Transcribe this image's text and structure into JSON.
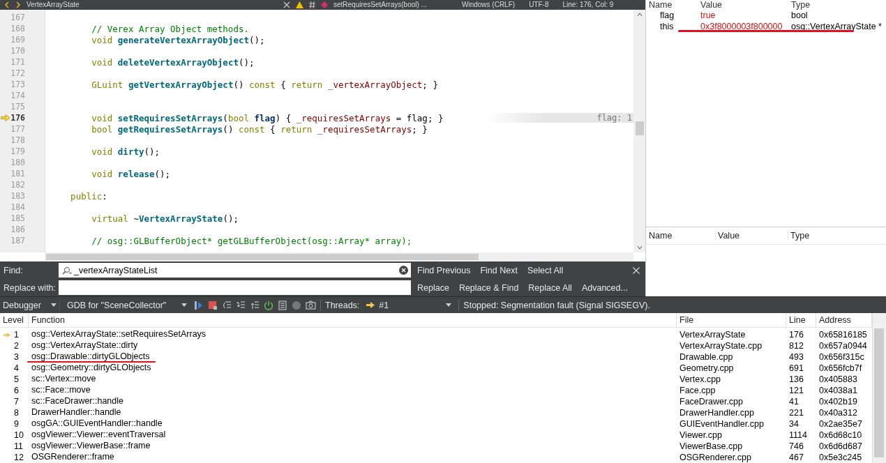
{
  "top_bar": {
    "file": "VertexArrayState",
    "symbol": "setRequiresSetArrays(bool) ...",
    "line_endings": "Windows (CRLF)",
    "encoding": "UTF-8",
    "position": "Line: 176, Col: 9"
  },
  "editor": {
    "lines": [
      {
        "number": "167",
        "current": false
      },
      {
        "number": "168",
        "current": false,
        "tokens": [
          {
            "kind": "comment",
            "text": "        // Verex Array Object methods."
          }
        ]
      },
      {
        "number": "169",
        "current": false,
        "tokens": [
          {
            "kind": "kw",
            "text": "        void "
          },
          {
            "kind": "fn",
            "text": "generateVertexArrayObject"
          },
          {
            "kind": "plain",
            "text": "();"
          }
        ]
      },
      {
        "number": "170",
        "current": false
      },
      {
        "number": "171",
        "current": false,
        "tokens": [
          {
            "kind": "kw",
            "text": "        void "
          },
          {
            "kind": "fn",
            "text": "deleteVertexArrayObject"
          },
          {
            "kind": "plain",
            "text": "();"
          }
        ]
      },
      {
        "number": "172",
        "current": false
      },
      {
        "number": "173",
        "current": false,
        "tokens": [
          {
            "kind": "kw",
            "text": "        GLuint "
          },
          {
            "kind": "fn",
            "text": "getVertexArrayObject"
          },
          {
            "kind": "plain",
            "text": "() "
          },
          {
            "kind": "kw",
            "text": "const"
          },
          {
            "kind": "plain",
            "text": " { "
          },
          {
            "kind": "kw",
            "text": "return "
          },
          {
            "kind": "member",
            "text": "_vertexArrayObject"
          },
          {
            "kind": "plain",
            "text": "; }"
          }
        ]
      },
      {
        "number": "174",
        "current": false
      },
      {
        "number": "175",
        "current": false
      },
      {
        "number": "176",
        "current": true,
        "hint": "flag: 1",
        "tokens": [
          {
            "kind": "kw",
            "text": "        void "
          },
          {
            "kind": "fn",
            "text": "setRequiresSetArrays"
          },
          {
            "kind": "plain",
            "text": "("
          },
          {
            "kind": "kw",
            "text": "bool "
          },
          {
            "kind": "param",
            "text": "flag"
          },
          {
            "kind": "plain",
            "text": ") { "
          },
          {
            "kind": "member",
            "text": "_requiresSetArrays"
          },
          {
            "kind": "plain",
            "text": " = flag; }"
          }
        ]
      },
      {
        "number": "177",
        "current": false,
        "tokens": [
          {
            "kind": "kw",
            "text": "        bool "
          },
          {
            "kind": "fn",
            "text": "getRequiresSetArrays"
          },
          {
            "kind": "plain",
            "text": "() "
          },
          {
            "kind": "kw",
            "text": "const"
          },
          {
            "kind": "plain",
            "text": " { "
          },
          {
            "kind": "kw",
            "text": "return "
          },
          {
            "kind": "member",
            "text": "_requiresSetArrays"
          },
          {
            "kind": "plain",
            "text": "; }"
          }
        ]
      },
      {
        "number": "178",
        "current": false
      },
      {
        "number": "179",
        "current": false,
        "tokens": [
          {
            "kind": "kw",
            "text": "        void "
          },
          {
            "kind": "fn",
            "text": "dirty"
          },
          {
            "kind": "plain",
            "text": "();"
          }
        ]
      },
      {
        "number": "180",
        "current": false
      },
      {
        "number": "181",
        "current": false,
        "tokens": [
          {
            "kind": "kw",
            "text": "        void "
          },
          {
            "kind": "fn",
            "text": "release"
          },
          {
            "kind": "plain",
            "text": "();"
          }
        ]
      },
      {
        "number": "182",
        "current": false
      },
      {
        "number": "183",
        "current": false,
        "tokens": [
          {
            "kind": "kw",
            "text": "    public"
          },
          {
            "kind": "plain",
            "text": ":"
          }
        ]
      },
      {
        "number": "184",
        "current": false
      },
      {
        "number": "185",
        "current": false,
        "tokens": [
          {
            "kind": "kw",
            "text": "        virtual "
          },
          {
            "kind": "plain",
            "text": "~"
          },
          {
            "kind": "fn",
            "text": "VertexArrayState"
          },
          {
            "kind": "plain",
            "text": "();"
          }
        ]
      },
      {
        "number": "186",
        "current": false
      },
      {
        "number": "187",
        "current": false,
        "tokens": [
          {
            "kind": "comment",
            "text": "        // osg::GLBufferObject* getGLBufferObject(osg::Array* array);"
          }
        ]
      }
    ]
  },
  "locals": {
    "columns": [
      "Name",
      "Value",
      "Type"
    ],
    "rows": [
      {
        "name": "flag",
        "value": "true",
        "type": "bool",
        "marked": false
      },
      {
        "name": "this",
        "value": "0x3f8000003f800000",
        "type": "osg::VertexArrayState *",
        "marked": true
      }
    ]
  },
  "expressions": {
    "columns": [
      "Name",
      "Value",
      "Type"
    ]
  },
  "find_bar": {
    "find_label": "Find:",
    "find_value": "_vertexArrayStateList",
    "replace_label": "Replace with:",
    "buttons_top": [
      "Find Previous",
      "Find Next",
      "Select All"
    ],
    "buttons_bottom": [
      "Replace",
      "Replace & Find",
      "Replace All",
      "Advanced..."
    ]
  },
  "debugger_bar": {
    "view": "Debugger",
    "engine": "GDB for \"SceneCollector\"",
    "threads_label": "Threads:",
    "thread": "#1",
    "status": "Stopped: Segmentation fault (Signal SIGSEGV)."
  },
  "stack": {
    "columns": [
      "Level",
      "Function",
      "File",
      "Line",
      "Address"
    ],
    "rows": [
      {
        "level": "1",
        "function": "osg::VertexArrayState::setRequiresSetArrays",
        "file": "VertexArrayState",
        "line": "176",
        "address": "0x65816185",
        "current": true,
        "marked": false
      },
      {
        "level": "2",
        "function": "osg::VertexArrayState::dirty",
        "file": "VertexArrayState.cpp",
        "line": "812",
        "address": "0x657a0944",
        "current": false,
        "marked": false
      },
      {
        "level": "3",
        "function": "osg::Drawable::dirtyGLObjects",
        "file": "Drawable.cpp",
        "line": "493",
        "address": "0x656f315c",
        "current": false,
        "marked": true
      },
      {
        "level": "4",
        "function": "osg::Geometry::dirtyGLObjects",
        "file": "Geometry.cpp",
        "line": "691",
        "address": "0x656fcb7f",
        "current": false,
        "marked": false
      },
      {
        "level": "5",
        "function": "sc::Vertex::move",
        "file": "Vertex.cpp",
        "line": "136",
        "address": "0x405883",
        "current": false,
        "marked": false
      },
      {
        "level": "6",
        "function": "sc::Face::move",
        "file": "Face.cpp",
        "line": "121",
        "address": "0x4038a1",
        "current": false,
        "marked": false
      },
      {
        "level": "7",
        "function": "sc::FaceDrawer::handle",
        "file": "FaceDrawer.cpp",
        "line": "41",
        "address": "0x402b19",
        "current": false,
        "marked": false
      },
      {
        "level": "8",
        "function": "DrawerHandler::handle",
        "file": "DrawerHandler.cpp",
        "line": "221",
        "address": "0x40a312",
        "current": false,
        "marked": false
      },
      {
        "level": "9",
        "function": "osgGA::GUIEventHandler::handle",
        "file": "GUIEventHandler.cpp",
        "line": "34",
        "address": "0x2ae35e7",
        "current": false,
        "marked": false
      },
      {
        "level": "10",
        "function": "osgViewer::Viewer::eventTraversal",
        "file": "Viewer.cpp",
        "line": "1114",
        "address": "0x6d68c10",
        "current": false,
        "marked": false
      },
      {
        "level": "11",
        "function": "osgViewer::ViewerBase::frame",
        "file": "ViewerBase.cpp",
        "line": "746",
        "address": "0x6d6d687",
        "current": false,
        "marked": false
      },
      {
        "level": "12",
        "function": "OSGRenderer::frame",
        "file": "OSGRenderer.cpp",
        "line": "467",
        "address": "0x5e3c245",
        "current": false,
        "marked": false
      }
    ]
  }
}
